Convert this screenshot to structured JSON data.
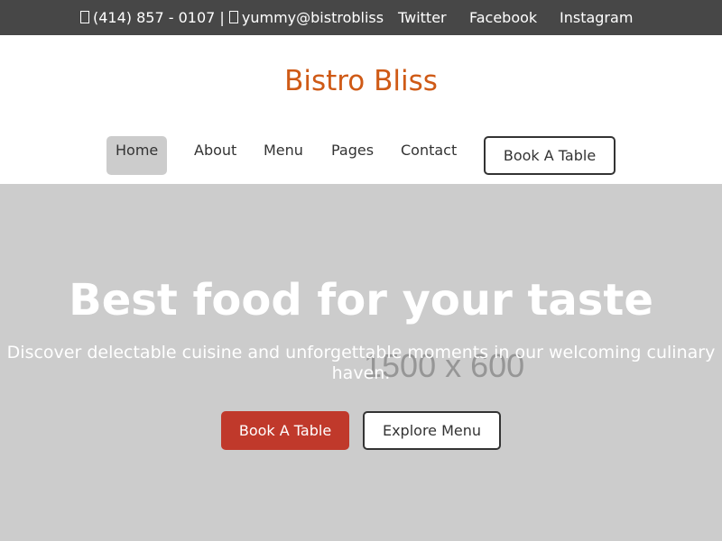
{
  "topbar": {
    "phone": "(414) 857 - 0107",
    "separator": "|",
    "email": "yummy@bistrobliss",
    "social": [
      "Twitter",
      "Facebook",
      "Instagram"
    ],
    "icons": {
      "phone": "phone-icon",
      "email": "mail-icon"
    }
  },
  "header": {
    "brand": "Bistro Bliss",
    "nav": [
      "Home",
      "About",
      "Menu",
      "Pages",
      "Contact"
    ],
    "active_nav": "Home",
    "book_button": "Book A Table"
  },
  "hero": {
    "title": "Best food for your taste",
    "subtitle": "Discover delectable cuisine and unforgettable moments in our welcoming culinary haven.",
    "placeholder": "1500 x 600",
    "primary_button": "Book A Table",
    "secondary_button": "Explore Menu"
  },
  "colors": {
    "topbar_bg": "#474747",
    "brand": "#cf5a16",
    "hero_bg": "#cccccc",
    "primary_button": "#c0392b",
    "nav_active_bg": "#cccccc"
  }
}
